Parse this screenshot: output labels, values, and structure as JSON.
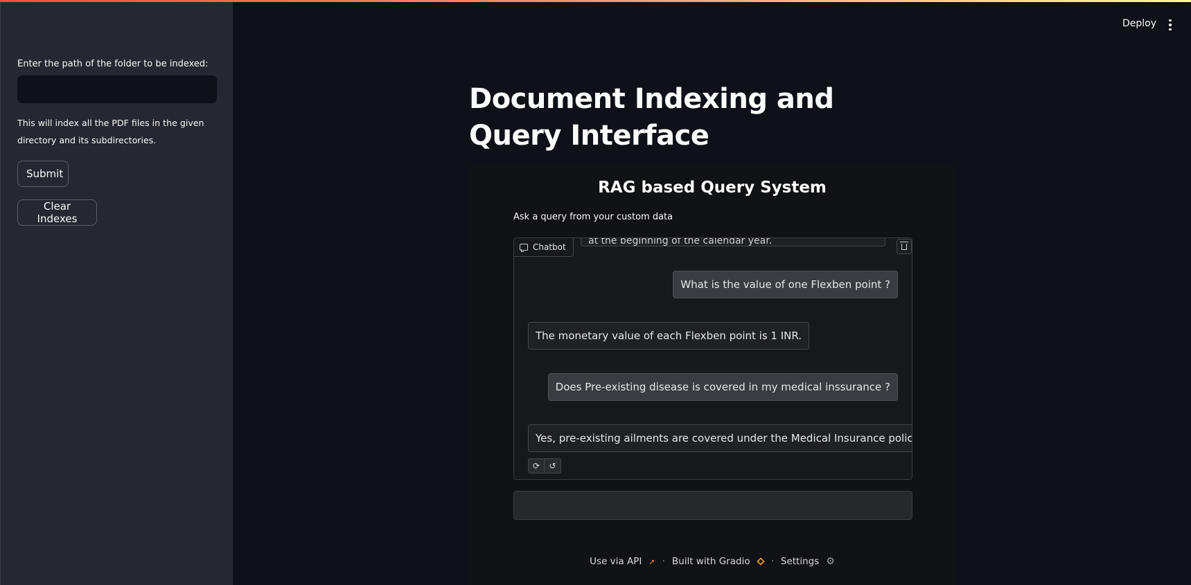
{
  "sidebar": {
    "folder_label": "Enter the path of the folder to be indexed:",
    "folder_value": "",
    "help_text": "This will index all the PDF files in the given directory and its subdirectories.",
    "submit_label": "Submit",
    "clear_label": "Clear Indexes"
  },
  "header": {
    "deploy_label": "Deploy"
  },
  "main": {
    "title": "Document Indexing and Query Interface"
  },
  "gradio": {
    "title": "RAG based Query System",
    "subtitle": "Ask a query from your custom data",
    "chatbot_label": "Chatbot",
    "partial_message": "at the beginning of the calendar year.",
    "messages": [
      {
        "role": "user",
        "text": "What is the value of one Flexben point ?"
      },
      {
        "role": "bot",
        "text": "The monetary value of each Flexben point is 1 INR."
      },
      {
        "role": "user",
        "text": "Does Pre-existing disease is covered in my medical inssurance ?"
      },
      {
        "role": "bot",
        "text": "Yes, pre-existing ailments are covered under the Medical Insurance policy."
      }
    ],
    "query_value": "",
    "footer": {
      "api_label": "Use via API",
      "built_label": "Built with Gradio",
      "settings_label": "Settings"
    }
  },
  "colors": {
    "background": "#0e1117",
    "sidebar": "#262730",
    "accent_gradient_start": "#ff4b4b",
    "accent_gradient_end": "#fffd80"
  }
}
